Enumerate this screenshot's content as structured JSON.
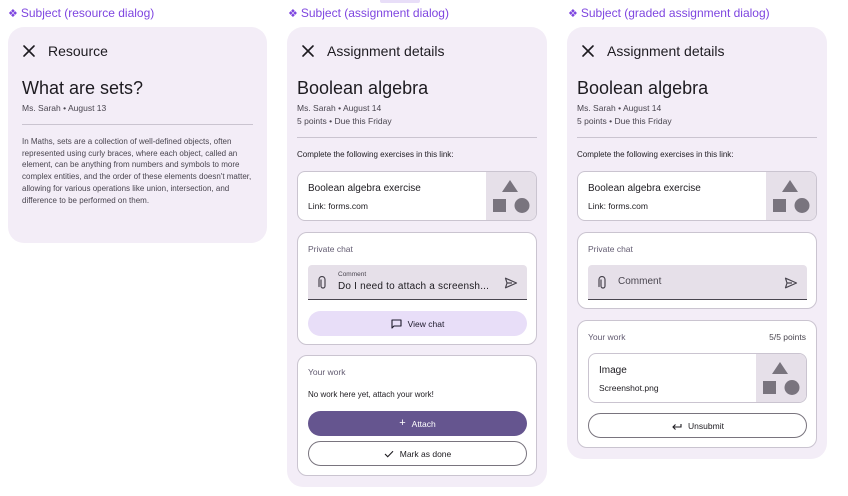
{
  "frames": [
    {
      "label": "Subject (resource dialog)",
      "header_title": "Resource",
      "title": "What are sets?",
      "meta_line1": "Ms. Sarah • August 13",
      "body": "In Maths, sets are a collection of well-defined objects, often represented using curly braces, where each object, called an element, can be anything from numbers and symbols to more complex entities, and the order of these elements doesn't matter, allowing for various operations like union, intersection, and difference to be performed on them."
    },
    {
      "label": "Subject (assignment dialog)",
      "header_title": "Assignment details",
      "title": "Boolean algebra",
      "meta_line1": "Ms. Sarah • August 14",
      "meta_line2": "5 points • Due this Friday",
      "instructions": "Complete the following exercises in this link:",
      "link_card": {
        "title": "Boolean algebra exercise",
        "subtitle": "Link: forms.com"
      },
      "private_chat": {
        "label": "Private chat",
        "comment_label": "Comment",
        "comment_value": "Do I need to attach a screensh...",
        "view_chat_button": "View chat"
      },
      "your_work": {
        "label": "Your work",
        "empty_text": "No work here yet, attach your work!",
        "attach_button": "Attach",
        "mark_done_button": "Mark as done"
      }
    },
    {
      "label": "Subject (graded assignment dialog)",
      "header_title": "Assignment details",
      "title": "Boolean algebra",
      "meta_line1": "Ms. Sarah • August 14",
      "meta_line2": "5 points • Due this Friday",
      "instructions": "Complete the following exercises in this link:",
      "link_card": {
        "title": "Boolean algebra exercise",
        "subtitle": "Link: forms.com"
      },
      "private_chat": {
        "label": "Private chat",
        "comment_placeholder": "Comment"
      },
      "your_work": {
        "label": "Your work",
        "points": "5/5 points",
        "file_card": {
          "title": "Image",
          "subtitle": "Screenshot.png"
        },
        "unsubmit_button": "Unsubmit"
      }
    }
  ],
  "icons": {
    "close": "close-icon",
    "paperclip": "paperclip-icon",
    "send": "send-icon",
    "chat": "chat-icon",
    "plus": "plus-icon",
    "check": "check-icon",
    "undo": "undo-arrow-icon",
    "shapes": "shapes-placeholder-icon"
  },
  "colors": {
    "panel_bg": "#f3edf7",
    "accent_purple": "#65558f",
    "tonal": "#e8def8",
    "frame_label": "#7e45e0"
  }
}
